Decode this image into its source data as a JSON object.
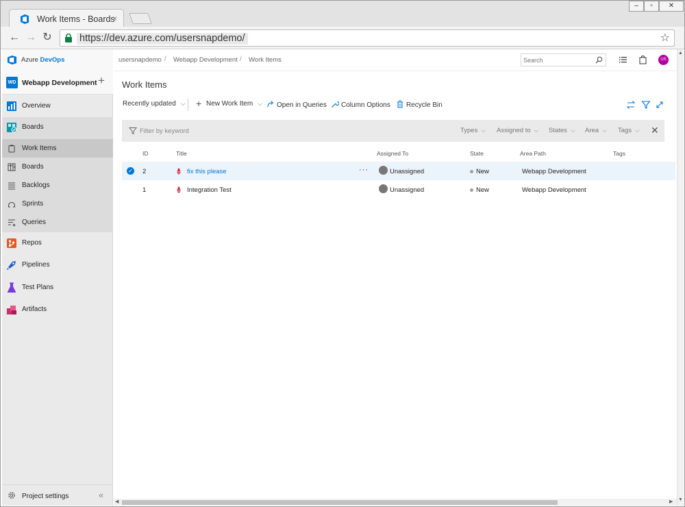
{
  "browser": {
    "tab_title": "Work Items - Boards",
    "tab_close": "×",
    "url": "https://dev.azure.com/usersnapdemo/"
  },
  "app": {
    "brand_prefix": "Azure ",
    "brand_suffix": "DevOps",
    "project_badge": "WD",
    "project_name": "Webapp Development",
    "nav": {
      "overview": "Overview",
      "boards": "Boards",
      "work_items": "Work Items",
      "boards_sub": "Boards",
      "backlogs": "Backlogs",
      "sprints": "Sprints",
      "queries": "Queries",
      "repos": "Repos",
      "pipelines": "Pipelines",
      "test_plans": "Test Plans",
      "artifacts": "Artifacts"
    },
    "project_settings": "Project settings",
    "collapse_label": "«"
  },
  "header": {
    "breadcrumbs": [
      "usersnapdemo",
      "Webapp Development",
      "Work Items"
    ],
    "search_placeholder": "Search",
    "avatar_initials": "US"
  },
  "page": {
    "title": "Work Items",
    "view_selector": "Recently updated",
    "commands": {
      "new_work_item": "New Work Item",
      "open_in_queries": "Open in Queries",
      "column_options": "Column Options",
      "recycle_bin": "Recycle Bin"
    },
    "filter": {
      "keyword_placeholder": "Filter by keyword",
      "types": "Types",
      "assigned_to": "Assigned to",
      "states": "States",
      "area": "Area",
      "tags": "Tags"
    }
  },
  "table": {
    "columns": {
      "id": "ID",
      "title": "Title",
      "assigned_to": "Assigned To",
      "state": "State",
      "area_path": "Area Path",
      "tags": "Tags"
    },
    "rows": [
      {
        "id": "2",
        "title": "fix this please",
        "assigned_to": "Unassigned",
        "state": "New",
        "area_path": "Webapp Development",
        "tags": "",
        "more": "···"
      },
      {
        "id": "1",
        "title": "Integration Test",
        "assigned_to": "Unassigned",
        "state": "New",
        "area_path": "Webapp Development",
        "tags": ""
      }
    ]
  },
  "colors": {
    "accent": "#0078d4",
    "bug": "#cc293d",
    "avatar": "#b4009e",
    "selected_row": "#ebf3fb"
  }
}
